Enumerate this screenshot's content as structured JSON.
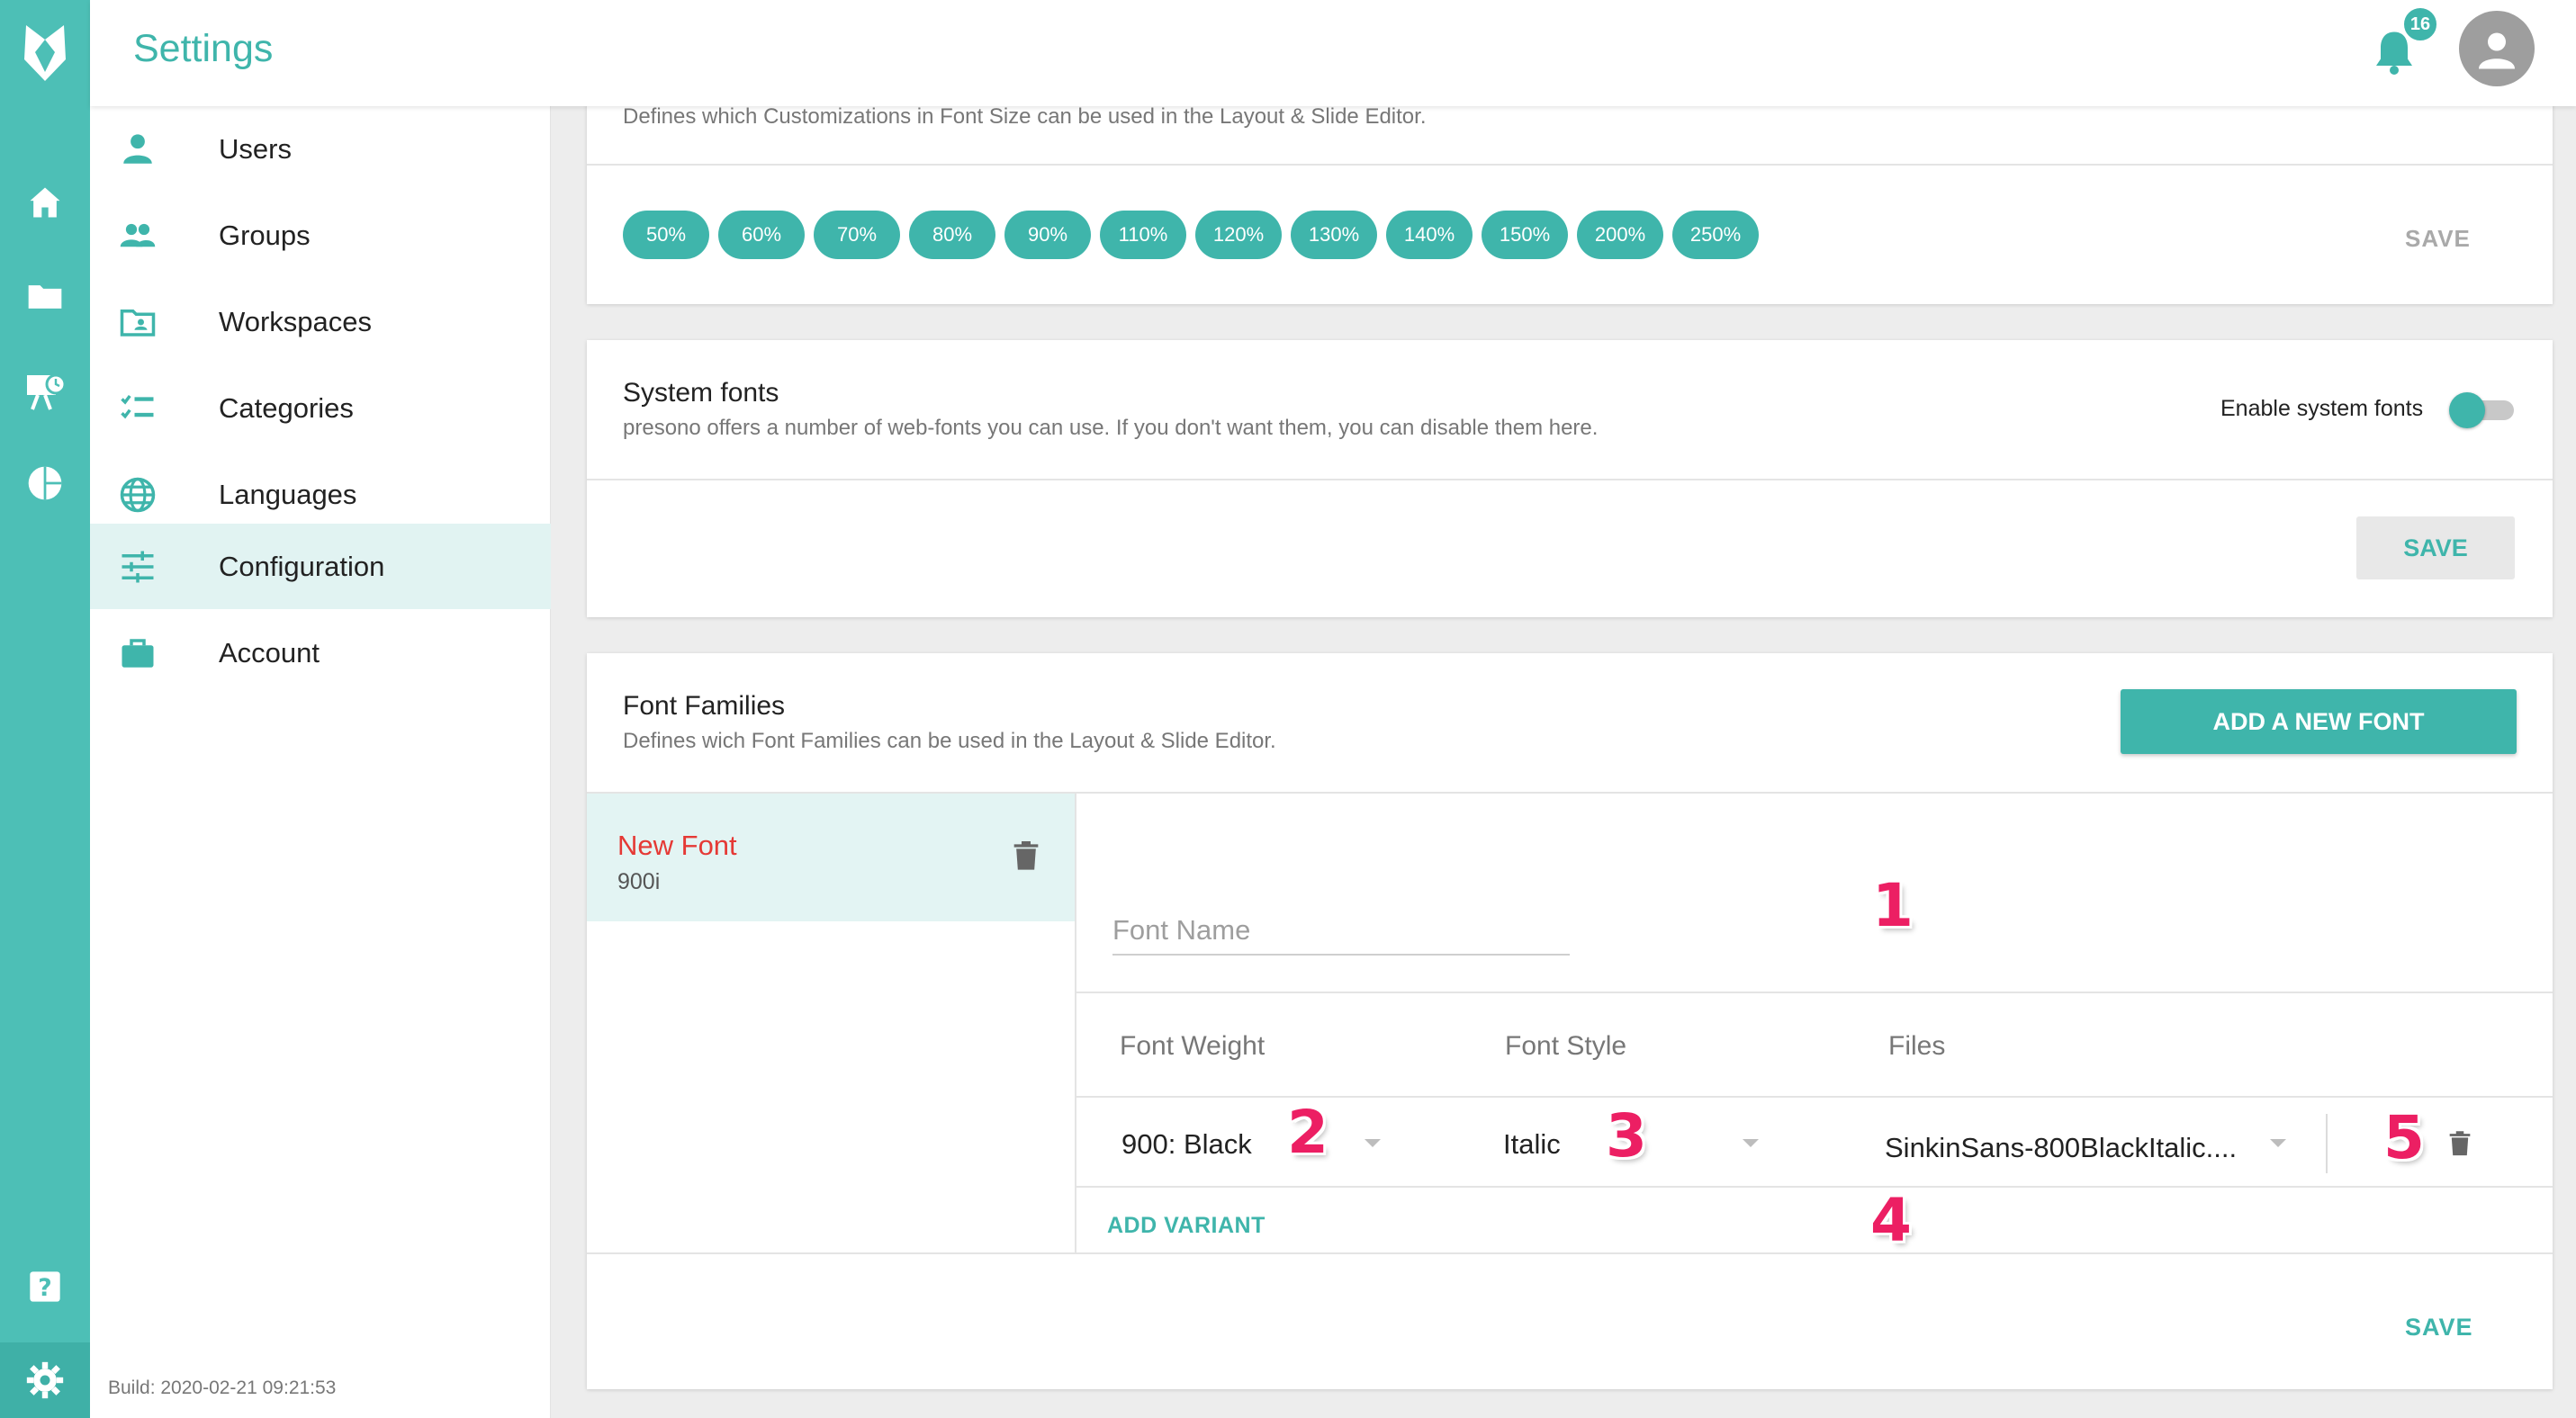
{
  "header": {
    "title": "Settings",
    "notification_count": "16"
  },
  "rail": {
    "icons": [
      "logo-icon",
      "home-icon",
      "folder-icon",
      "presentation-icon",
      "pie-chart-icon",
      "help-icon",
      "gear-icon"
    ]
  },
  "sidebar": {
    "items": [
      {
        "label": "Users",
        "icon": "person-icon"
      },
      {
        "label": "Groups",
        "icon": "group-icon"
      },
      {
        "label": "Workspaces",
        "icon": "workspace-icon"
      },
      {
        "label": "Categories",
        "icon": "checklist-icon"
      },
      {
        "label": "Languages",
        "icon": "globe-icon"
      },
      {
        "label": "Configuration",
        "icon": "sliders-icon",
        "active": true
      },
      {
        "label": "Account",
        "icon": "briefcase-icon"
      }
    ],
    "build": "Build: 2020-02-21 09:21:53"
  },
  "font_size_card": {
    "description": "Defines which Customizations in Font Size can be used in the Layout & Slide Editor.",
    "chips": [
      "50%",
      "60%",
      "70%",
      "80%",
      "90%",
      "110%",
      "120%",
      "130%",
      "140%",
      "150%",
      "200%",
      "250%"
    ],
    "save_label": "SAVE"
  },
  "system_fonts_card": {
    "title": "System fonts",
    "description": "presono offers a number of web-fonts you can use. If you don't want them, you can disable them here.",
    "toggle_label": "Enable system fonts",
    "save_label": "SAVE"
  },
  "font_families_card": {
    "title": "Font Families",
    "description": "Defines wich Font Families can be used in the Layout & Slide Editor.",
    "add_button": "ADD A NEW FONT",
    "fonts": [
      {
        "name": "New Font",
        "variant": "900i"
      }
    ],
    "font_name_placeholder": "Font Name",
    "columns": [
      "Font Weight",
      "Font Style",
      "Files"
    ],
    "variant_row": {
      "weight": "900: Black",
      "style": "Italic",
      "file": "SinkinSans-800BlackItalic...."
    },
    "add_variant": "ADD VARIANT",
    "save_label": "SAVE"
  },
  "markers": [
    "1",
    "2",
    "3",
    "4",
    "5"
  ]
}
